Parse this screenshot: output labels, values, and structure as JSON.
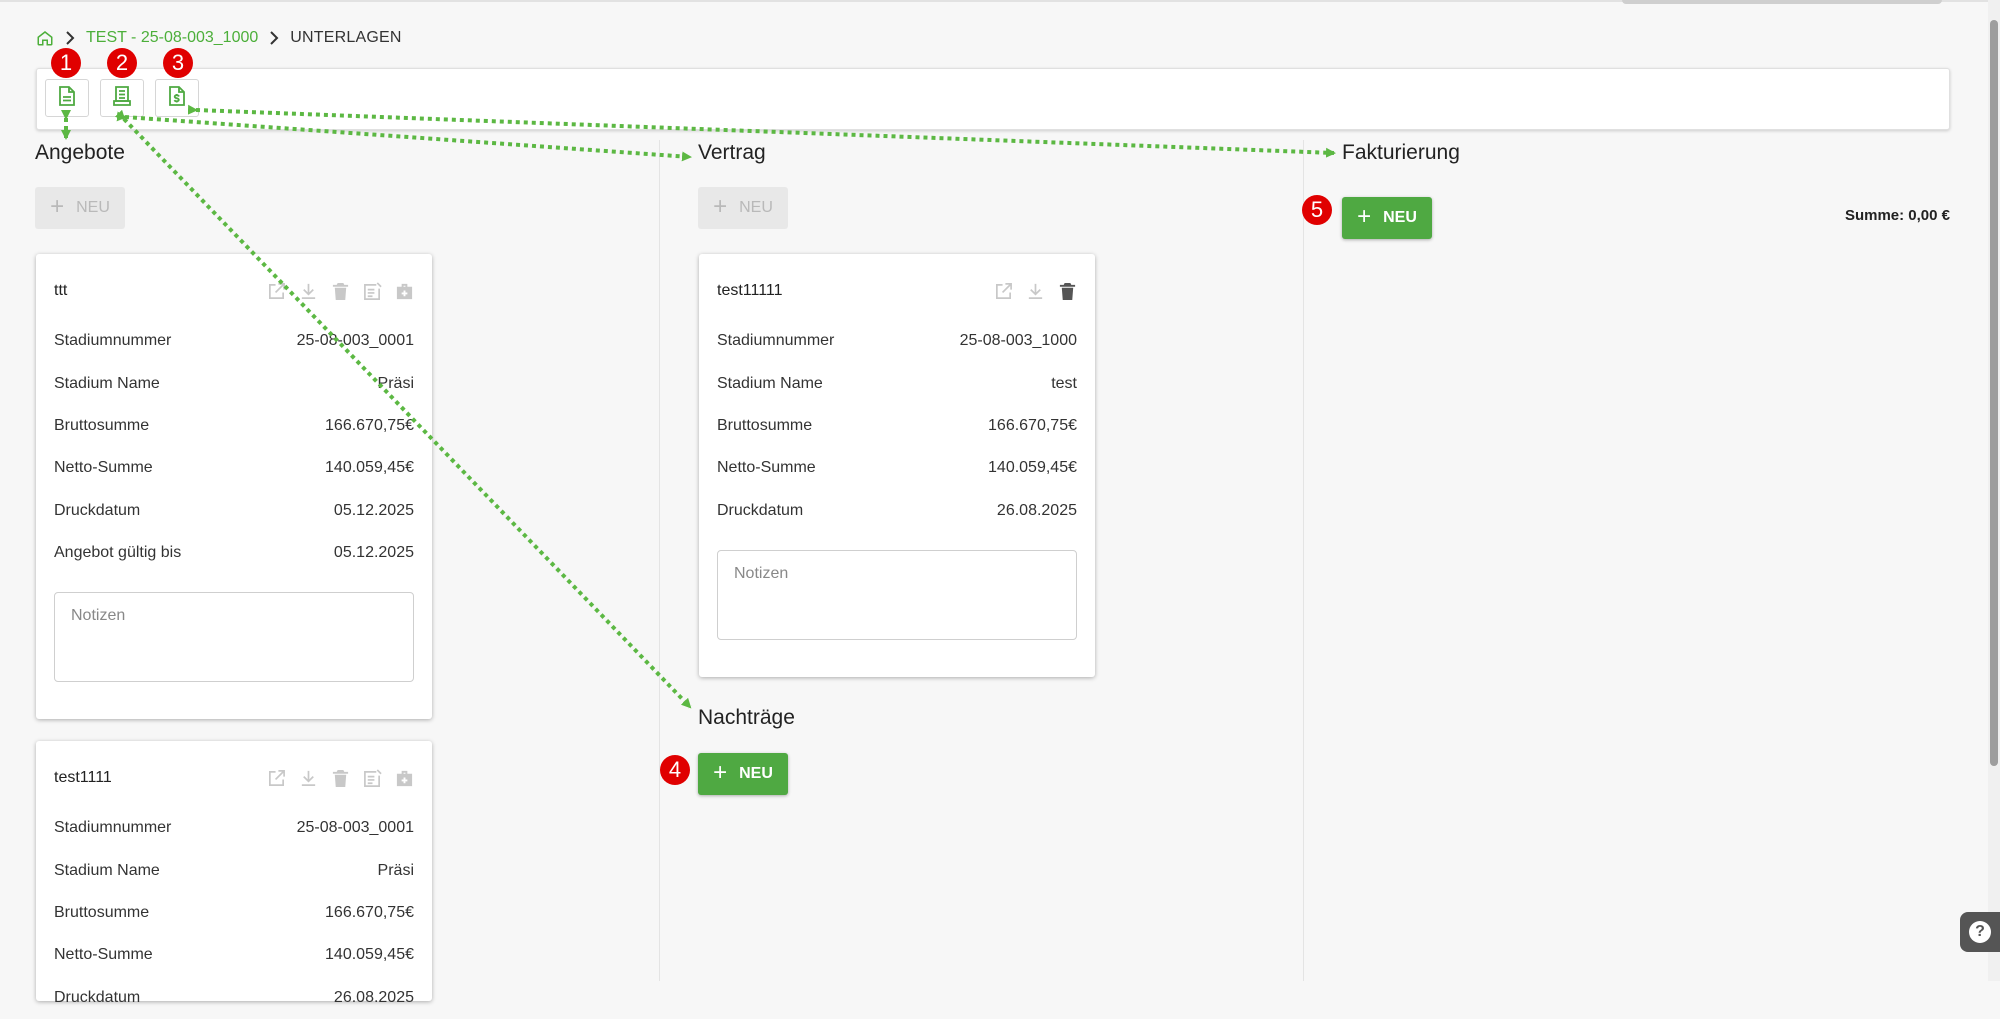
{
  "breadcrumb": {
    "project": "TEST - 25-08-003_1000",
    "current": "UNTERLAGEN"
  },
  "badges": [
    "1",
    "2",
    "3",
    "4",
    "5"
  ],
  "columns": {
    "angebote": {
      "title": "Angebote",
      "new_label": "NEU"
    },
    "vertrag": {
      "title": "Vertrag",
      "new_label": "NEU"
    },
    "nachtraege": {
      "title": "Nachträge",
      "new_label": "NEU"
    },
    "fakturierung": {
      "title": "Fakturierung",
      "new_label": "NEU",
      "sum": "Summe: 0,00 €"
    }
  },
  "angebote_cards": [
    {
      "title": "ttt",
      "rows": [
        {
          "label": "Stadiumnummer",
          "value": "25-08-003_0001"
        },
        {
          "label": "Stadium Name",
          "value": "Präsi"
        },
        {
          "label": "Bruttosumme",
          "value": "166.670,75€"
        },
        {
          "label": "Netto-Summe",
          "value": "140.059,45€"
        },
        {
          "label": "Druckdatum",
          "value": "05.12.2025"
        },
        {
          "label": "Angebot gültig bis",
          "value": "05.12.2025"
        }
      ],
      "notes_placeholder": "Notizen"
    },
    {
      "title": "test1111",
      "rows": [
        {
          "label": "Stadiumnummer",
          "value": "25-08-003_0001"
        },
        {
          "label": "Stadium Name",
          "value": "Präsi"
        },
        {
          "label": "Bruttosumme",
          "value": "166.670,75€"
        },
        {
          "label": "Netto-Summe",
          "value": "140.059,45€"
        },
        {
          "label": "Druckdatum",
          "value": "26.08.2025"
        }
      ]
    }
  ],
  "vertrag_card": {
    "title": "test11111",
    "rows": [
      {
        "label": "Stadiumnummer",
        "value": "25-08-003_1000"
      },
      {
        "label": "Stadium Name",
        "value": "test"
      },
      {
        "label": "Bruttosumme",
        "value": "166.670,75€"
      },
      {
        "label": "Netto-Summe",
        "value": "140.059,45€"
      },
      {
        "label": "Druckdatum",
        "value": "26.08.2025"
      }
    ],
    "notes_placeholder": "Notizen"
  },
  "help_label": "?",
  "colors": {
    "accent": "#4fa942",
    "badge": "#e00000",
    "arrow": "#5cb843"
  },
  "icons": [
    "home-icon",
    "document-icon",
    "receipt-icon",
    "invoice-icon",
    "edit-icon",
    "download-icon",
    "trash-icon",
    "note-icon",
    "briefcase-icon",
    "help-icon"
  ]
}
